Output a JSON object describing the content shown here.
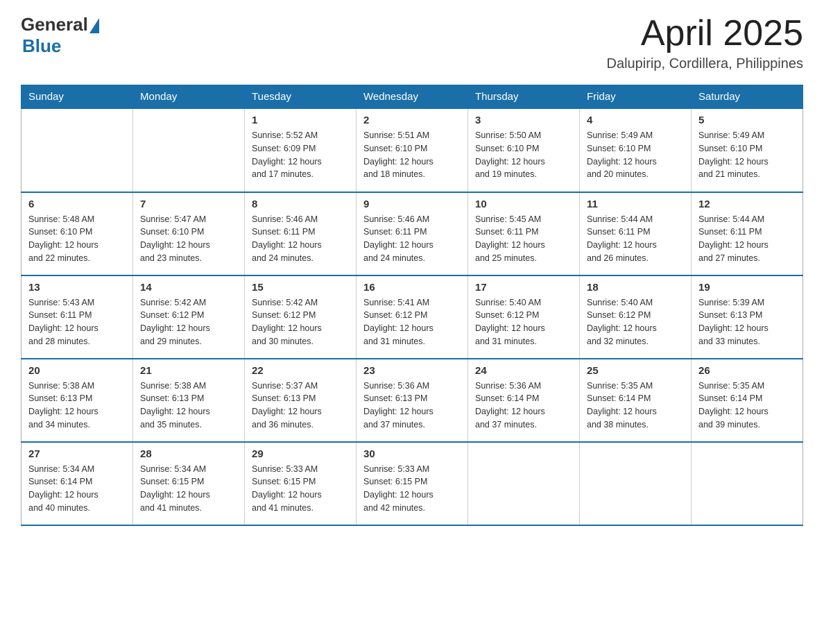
{
  "header": {
    "logo_general": "General",
    "logo_blue": "Blue",
    "title": "April 2025",
    "location": "Dalupirip, Cordillera, Philippines"
  },
  "weekdays": [
    "Sunday",
    "Monday",
    "Tuesday",
    "Wednesday",
    "Thursday",
    "Friday",
    "Saturday"
  ],
  "weeks": [
    [
      {
        "day": "",
        "details": []
      },
      {
        "day": "",
        "details": []
      },
      {
        "day": "1",
        "details": [
          "Sunrise: 5:52 AM",
          "Sunset: 6:09 PM",
          "Daylight: 12 hours",
          "and 17 minutes."
        ]
      },
      {
        "day": "2",
        "details": [
          "Sunrise: 5:51 AM",
          "Sunset: 6:10 PM",
          "Daylight: 12 hours",
          "and 18 minutes."
        ]
      },
      {
        "day": "3",
        "details": [
          "Sunrise: 5:50 AM",
          "Sunset: 6:10 PM",
          "Daylight: 12 hours",
          "and 19 minutes."
        ]
      },
      {
        "day": "4",
        "details": [
          "Sunrise: 5:49 AM",
          "Sunset: 6:10 PM",
          "Daylight: 12 hours",
          "and 20 minutes."
        ]
      },
      {
        "day": "5",
        "details": [
          "Sunrise: 5:49 AM",
          "Sunset: 6:10 PM",
          "Daylight: 12 hours",
          "and 21 minutes."
        ]
      }
    ],
    [
      {
        "day": "6",
        "details": [
          "Sunrise: 5:48 AM",
          "Sunset: 6:10 PM",
          "Daylight: 12 hours",
          "and 22 minutes."
        ]
      },
      {
        "day": "7",
        "details": [
          "Sunrise: 5:47 AM",
          "Sunset: 6:10 PM",
          "Daylight: 12 hours",
          "and 23 minutes."
        ]
      },
      {
        "day": "8",
        "details": [
          "Sunrise: 5:46 AM",
          "Sunset: 6:11 PM",
          "Daylight: 12 hours",
          "and 24 minutes."
        ]
      },
      {
        "day": "9",
        "details": [
          "Sunrise: 5:46 AM",
          "Sunset: 6:11 PM",
          "Daylight: 12 hours",
          "and 24 minutes."
        ]
      },
      {
        "day": "10",
        "details": [
          "Sunrise: 5:45 AM",
          "Sunset: 6:11 PM",
          "Daylight: 12 hours",
          "and 25 minutes."
        ]
      },
      {
        "day": "11",
        "details": [
          "Sunrise: 5:44 AM",
          "Sunset: 6:11 PM",
          "Daylight: 12 hours",
          "and 26 minutes."
        ]
      },
      {
        "day": "12",
        "details": [
          "Sunrise: 5:44 AM",
          "Sunset: 6:11 PM",
          "Daylight: 12 hours",
          "and 27 minutes."
        ]
      }
    ],
    [
      {
        "day": "13",
        "details": [
          "Sunrise: 5:43 AM",
          "Sunset: 6:11 PM",
          "Daylight: 12 hours",
          "and 28 minutes."
        ]
      },
      {
        "day": "14",
        "details": [
          "Sunrise: 5:42 AM",
          "Sunset: 6:12 PM",
          "Daylight: 12 hours",
          "and 29 minutes."
        ]
      },
      {
        "day": "15",
        "details": [
          "Sunrise: 5:42 AM",
          "Sunset: 6:12 PM",
          "Daylight: 12 hours",
          "and 30 minutes."
        ]
      },
      {
        "day": "16",
        "details": [
          "Sunrise: 5:41 AM",
          "Sunset: 6:12 PM",
          "Daylight: 12 hours",
          "and 31 minutes."
        ]
      },
      {
        "day": "17",
        "details": [
          "Sunrise: 5:40 AM",
          "Sunset: 6:12 PM",
          "Daylight: 12 hours",
          "and 31 minutes."
        ]
      },
      {
        "day": "18",
        "details": [
          "Sunrise: 5:40 AM",
          "Sunset: 6:12 PM",
          "Daylight: 12 hours",
          "and 32 minutes."
        ]
      },
      {
        "day": "19",
        "details": [
          "Sunrise: 5:39 AM",
          "Sunset: 6:13 PM",
          "Daylight: 12 hours",
          "and 33 minutes."
        ]
      }
    ],
    [
      {
        "day": "20",
        "details": [
          "Sunrise: 5:38 AM",
          "Sunset: 6:13 PM",
          "Daylight: 12 hours",
          "and 34 minutes."
        ]
      },
      {
        "day": "21",
        "details": [
          "Sunrise: 5:38 AM",
          "Sunset: 6:13 PM",
          "Daylight: 12 hours",
          "and 35 minutes."
        ]
      },
      {
        "day": "22",
        "details": [
          "Sunrise: 5:37 AM",
          "Sunset: 6:13 PM",
          "Daylight: 12 hours",
          "and 36 minutes."
        ]
      },
      {
        "day": "23",
        "details": [
          "Sunrise: 5:36 AM",
          "Sunset: 6:13 PM",
          "Daylight: 12 hours",
          "and 37 minutes."
        ]
      },
      {
        "day": "24",
        "details": [
          "Sunrise: 5:36 AM",
          "Sunset: 6:14 PM",
          "Daylight: 12 hours",
          "and 37 minutes."
        ]
      },
      {
        "day": "25",
        "details": [
          "Sunrise: 5:35 AM",
          "Sunset: 6:14 PM",
          "Daylight: 12 hours",
          "and 38 minutes."
        ]
      },
      {
        "day": "26",
        "details": [
          "Sunrise: 5:35 AM",
          "Sunset: 6:14 PM",
          "Daylight: 12 hours",
          "and 39 minutes."
        ]
      }
    ],
    [
      {
        "day": "27",
        "details": [
          "Sunrise: 5:34 AM",
          "Sunset: 6:14 PM",
          "Daylight: 12 hours",
          "and 40 minutes."
        ]
      },
      {
        "day": "28",
        "details": [
          "Sunrise: 5:34 AM",
          "Sunset: 6:15 PM",
          "Daylight: 12 hours",
          "and 41 minutes."
        ]
      },
      {
        "day": "29",
        "details": [
          "Sunrise: 5:33 AM",
          "Sunset: 6:15 PM",
          "Daylight: 12 hours",
          "and 41 minutes."
        ]
      },
      {
        "day": "30",
        "details": [
          "Sunrise: 5:33 AM",
          "Sunset: 6:15 PM",
          "Daylight: 12 hours",
          "and 42 minutes."
        ]
      },
      {
        "day": "",
        "details": []
      },
      {
        "day": "",
        "details": []
      },
      {
        "day": "",
        "details": []
      }
    ]
  ]
}
